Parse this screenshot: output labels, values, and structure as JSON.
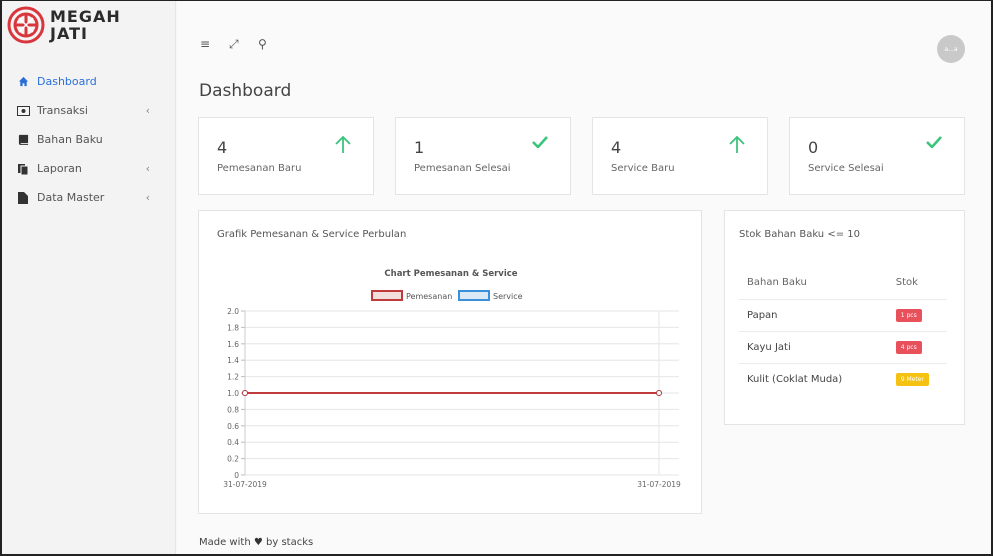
{
  "brand": {
    "line1": "MEGAH",
    "line2": "JATI"
  },
  "sidebar": {
    "items": [
      {
        "label": "Dashboard",
        "icon": "home-icon",
        "active": true,
        "has_chevron": false
      },
      {
        "label": "Transaksi",
        "icon": "money-icon",
        "active": false,
        "has_chevron": true
      },
      {
        "label": "Bahan Baku",
        "icon": "book-icon",
        "active": false,
        "has_chevron": false
      },
      {
        "label": "Laporan",
        "icon": "copy-icon",
        "active": false,
        "has_chevron": true
      },
      {
        "label": "Data Master",
        "icon": "file-icon",
        "active": false,
        "has_chevron": true
      }
    ],
    "chevron": "‹"
  },
  "topbar": {
    "menu_icon": "≡",
    "expand_icon": "⤢",
    "search_icon": "⚲",
    "avatar_text": "a...a"
  },
  "page": {
    "title": "Dashboard"
  },
  "stats": [
    {
      "value": "4",
      "label": "Pemesanan Baru",
      "icon": "arrow-up-icon"
    },
    {
      "value": "1",
      "label": "Pemesanan Selesai",
      "icon": "check-icon"
    },
    {
      "value": "4",
      "label": "Service Baru",
      "icon": "arrow-up-icon"
    },
    {
      "value": "0",
      "label": "Service Selesai",
      "icon": "check-icon"
    }
  ],
  "colors": {
    "accent": "#2a6fd6",
    "green": "#3cc47c",
    "red_badge": "#e8505b",
    "yellow_badge": "#f5c211",
    "pemesanan": "#c0393b",
    "service": "#3a8fd9"
  },
  "chart_card": {
    "title": "Grafik Pemesanan & Service Perbulan"
  },
  "chart_data": {
    "type": "line",
    "title": "Chart Pemesanan & Service",
    "x": [
      "31-07-2019",
      "31-07-2019"
    ],
    "series": [
      {
        "name": "Pemesanan",
        "values": [
          1,
          1
        ]
      },
      {
        "name": "Service",
        "values": [
          1,
          1
        ]
      }
    ],
    "ylim": [
      0,
      2
    ],
    "yticks": [
      "0",
      "0.2",
      "0.4",
      "0.6",
      "0.8",
      "1.0",
      "1.2",
      "1.4",
      "1.6",
      "1.8",
      "2.0"
    ],
    "grid": true,
    "legend": "top"
  },
  "stok": {
    "title": "Stok Bahan Baku <= 10",
    "headers": [
      "Bahan Baku",
      "Stok"
    ],
    "rows": [
      {
        "name": "Papan",
        "stok": "1 pcs",
        "level": "red"
      },
      {
        "name": "Kayu Jati",
        "stok": "4 pcs",
        "level": "red"
      },
      {
        "name": "Kulit (Coklat Muda)",
        "stok": "9 Meter",
        "level": "yellow"
      }
    ]
  },
  "footer": {
    "before": "Made with",
    "heart": "♥",
    "after": "by stacks"
  }
}
